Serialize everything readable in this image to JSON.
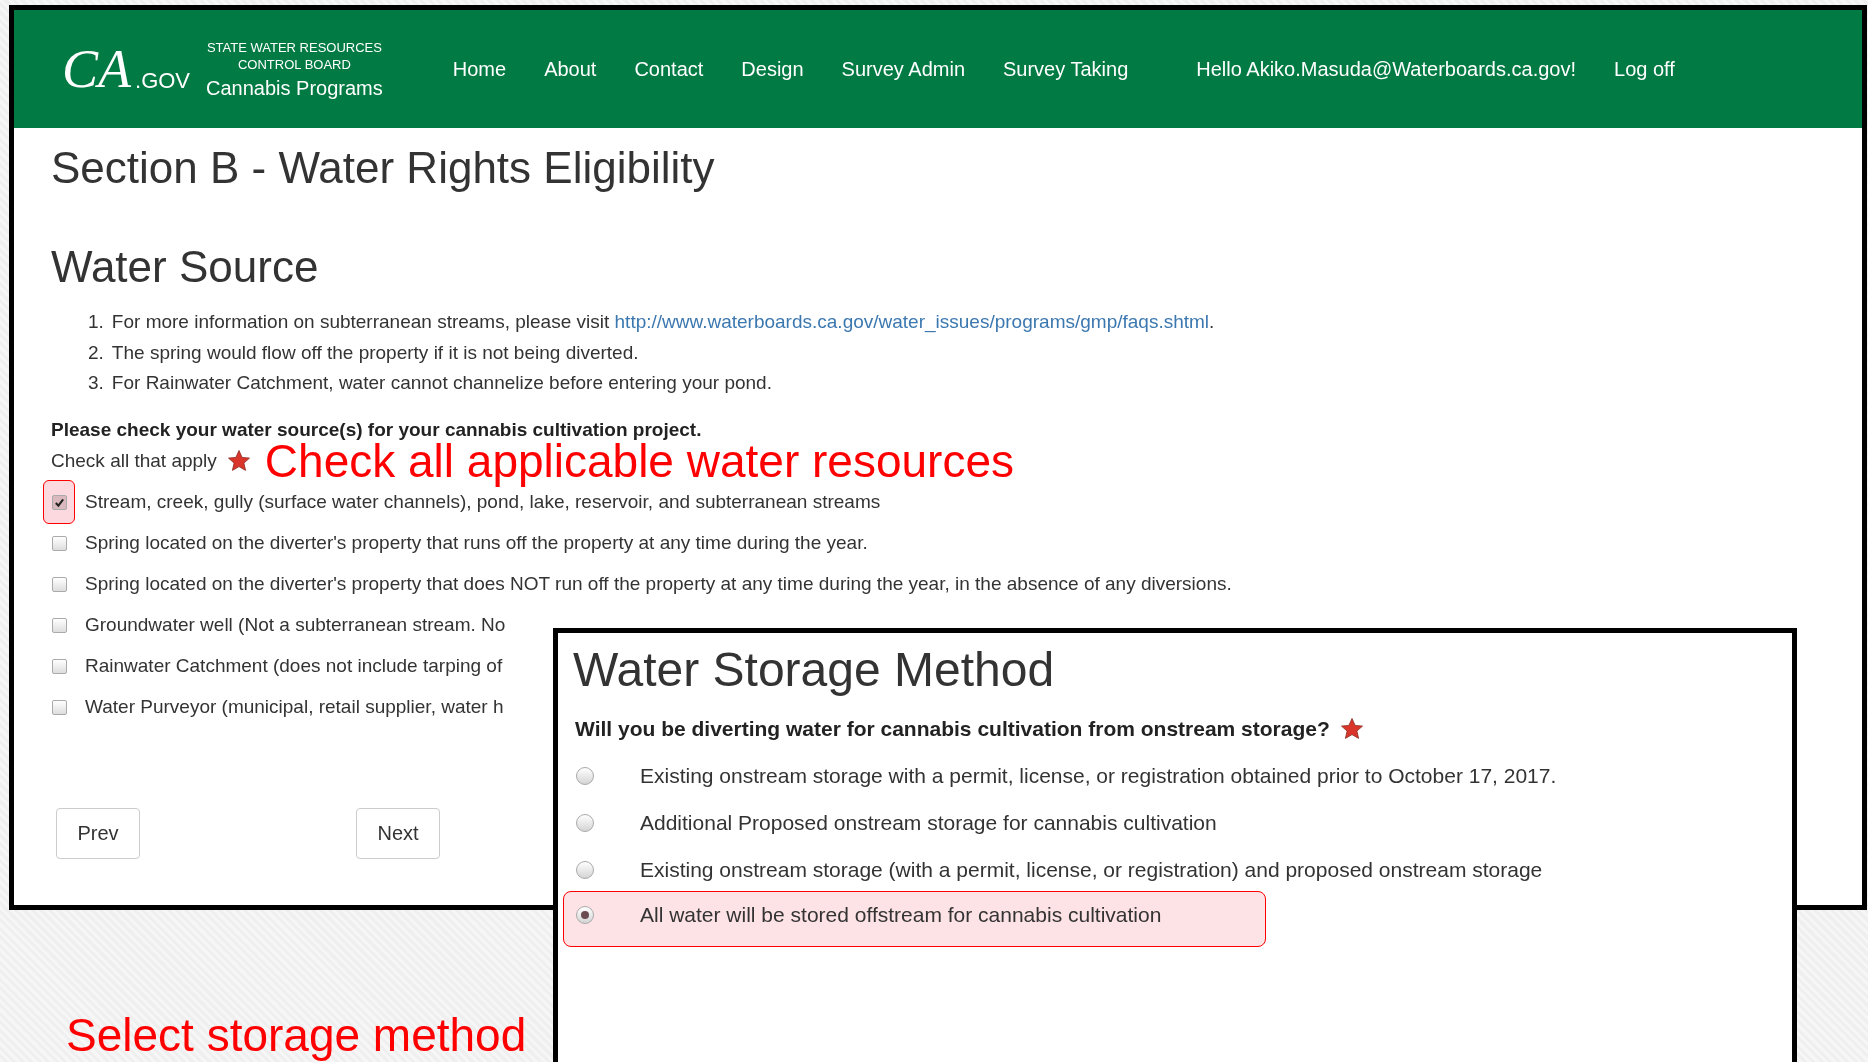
{
  "header": {
    "logo_mark": "CA",
    "logo_suffix": ".GOV",
    "agency": [
      "STATE WATER RESOURCES",
      "CONTROL BOARD"
    ],
    "program": "Cannabis Programs",
    "nav": [
      "Home",
      "About",
      "Contact",
      "Design",
      "Survey Admin",
      "Survey Taking"
    ],
    "greeting": "Hello Akiko.Masuda@Waterboards.ca.gov!",
    "logoff": "Log off"
  },
  "page_title": "Section B - Water Rights Eligibility",
  "water_source": {
    "heading": "Water Source",
    "notes": [
      {
        "number": "1.",
        "text": "For more information on subterranean streams, please visit ",
        "link": "http://www.waterboards.ca.gov/water_issues/programs/gmp/faqs.shtml",
        "after": "."
      },
      {
        "number": "2.",
        "text": "The spring would flow off the property if it is not being diverted."
      },
      {
        "number": "3.",
        "text": "For Rainwater Catchment, water cannot channelize before entering your pond."
      }
    ],
    "question": "Please check your water source(s) for your cannabis cultivation project.",
    "hint": "Check all that apply",
    "annotation": "Check all applicable water resources",
    "sources": [
      {
        "label": "Stream, creek, gully (surface water channels), pond, lake, reservoir, and subterranean streams",
        "checked": true,
        "highlighted": true
      },
      {
        "label": "Spring located on the diverter's property that runs off the property at any time during the year.",
        "checked": false,
        "highlighted": false
      },
      {
        "label": "Spring located on the diverter's property that does NOT run off the property at any time during the year, in the absence of any diversions.",
        "checked": false,
        "highlighted": false
      },
      {
        "label": "Groundwater well (Not a subterranean stream. No",
        "checked": false,
        "highlighted": false
      },
      {
        "label": "Rainwater Catchment (does not include tarping of",
        "checked": false,
        "highlighted": false
      },
      {
        "label": "Water Purveyor (municipal, retail supplier, water h",
        "checked": false,
        "highlighted": false
      }
    ]
  },
  "buttons": [
    "Prev",
    "Next"
  ],
  "storage": {
    "heading": "Water Storage Method",
    "question": "Will you be diverting water for cannabis cultivation from onstream storage?",
    "annotation": "Select storage method",
    "options": [
      {
        "label": "Existing onstream storage with a permit, license, or registration obtained prior to October 17, 2017.",
        "selected": false,
        "highlighted": false
      },
      {
        "label": "Additional Proposed onstream storage for cannabis cultivation",
        "selected": false,
        "highlighted": false
      },
      {
        "label": "Existing onstream storage (with a permit, license, or registration) and proposed onstream storage",
        "selected": false,
        "highlighted": false
      },
      {
        "label": "All water will be stored offstream for cannabis cultivation",
        "selected": true,
        "highlighted": true
      }
    ]
  }
}
